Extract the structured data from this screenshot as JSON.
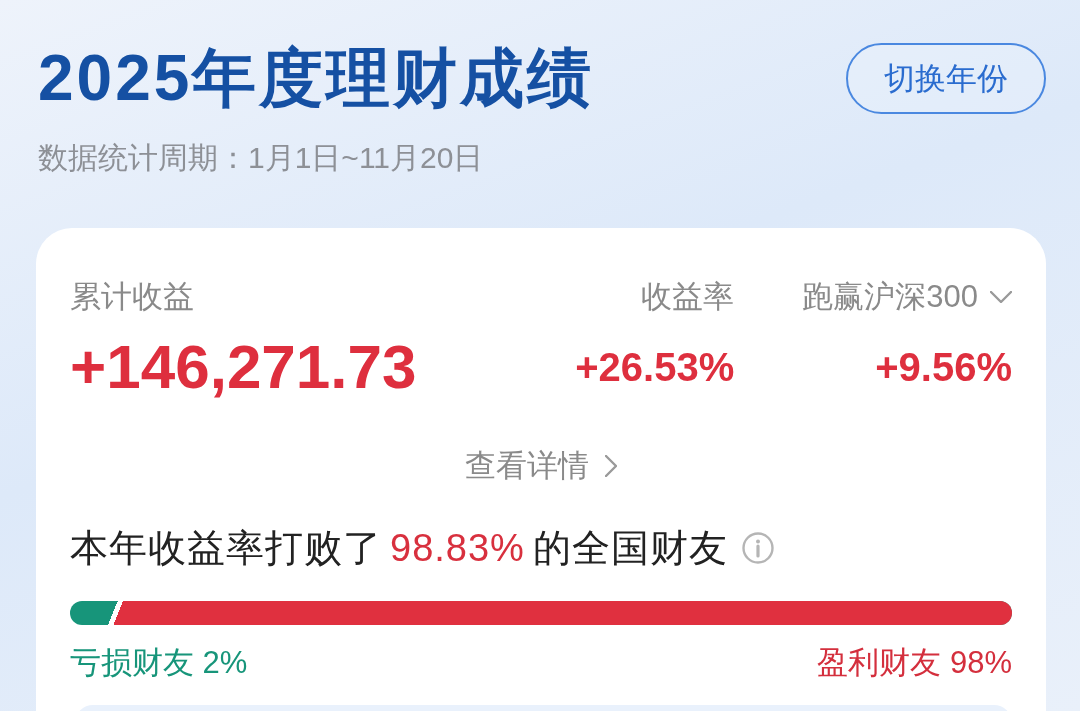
{
  "header": {
    "title": "2025年度理财成绩",
    "period": "数据统计周期：1月1日~11月20日",
    "switch_button": "切换年份"
  },
  "summary": {
    "metrics": [
      {
        "kind": "amount",
        "label": "累计收益",
        "value": "+146,271.73"
      },
      {
        "kind": "rate",
        "label": "收益率",
        "value": "+26.53%"
      },
      {
        "kind": "benchmark",
        "label": "跑赢沪深300",
        "value": "+9.56%"
      }
    ],
    "details_link": "查看详情"
  },
  "ranking": {
    "prefix": "本年收益率打败了",
    "highlight": "98.83%",
    "suffix": "的全国财友",
    "bar": {
      "level": 0.96
    },
    "loss_label": "亏损财友 2%",
    "profit_label": "盈利财友 98%"
  }
}
